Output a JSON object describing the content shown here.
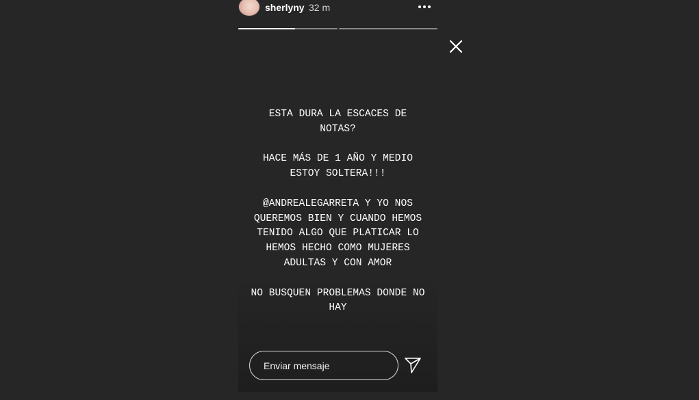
{
  "header": {
    "username": "sherlyny",
    "time_ago": "32 m",
    "more_icon": "more-horizontal-icon"
  },
  "progress": {
    "segments": [
      {
        "progress": 0.57
      },
      {
        "progress": 0
      }
    ]
  },
  "story": {
    "paragraphs": [
      "ESTA DURA LA ESCACES DE\nNOTAS?",
      "HACE MÁS DE 1 AÑO Y MEDIO\nESTOY SOLTERA!!!",
      "@ANDREALEGARRETA Y YO NOS\nQUEREMOS BIEN Y CUANDO HEMOS\nTENIDO ALGO QUE PLATICAR LO\nHEMOS HECHO COMO MUJERES\nADULTAS Y CON AMOR",
      "NO BUSQUEN PROBLEMAS DONDE NO\nHAY"
    ]
  },
  "reply": {
    "placeholder": "Enviar mensaje",
    "send_icon": "send-icon"
  },
  "close_icon": "close-icon",
  "colors": {
    "background": "#262626",
    "text": "#ffffff",
    "progress_track": "#8a8a8a",
    "progress_fill": "#ffffff"
  }
}
